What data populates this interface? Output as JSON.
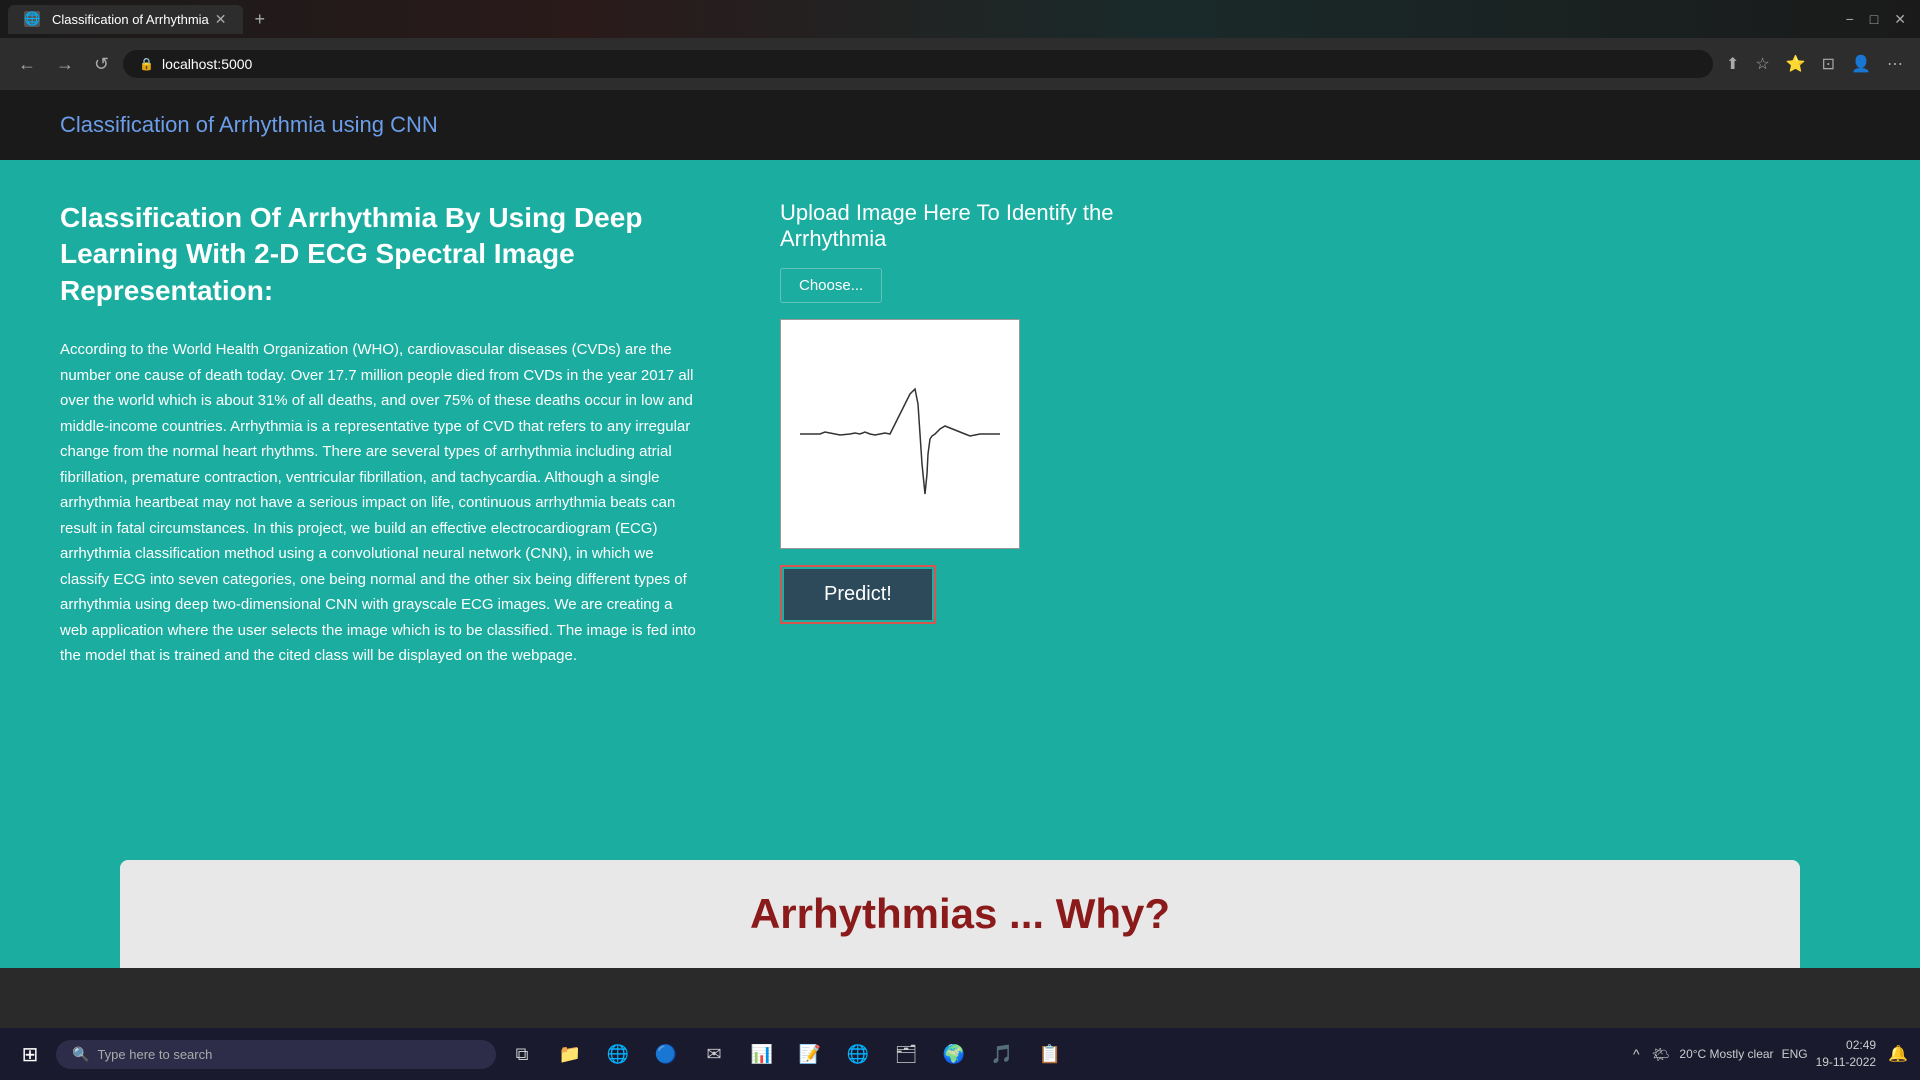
{
  "browser": {
    "tab_title": "Classification of Arrhythmia",
    "url": "localhost:5000",
    "new_tab_icon": "+",
    "back_icon": "←",
    "forward_icon": "→",
    "refresh_icon": "↺",
    "minimize_icon": "−",
    "maximize_icon": "□",
    "close_icon": "✕"
  },
  "header": {
    "title": "Classification of Arrhythmia using CNN"
  },
  "main": {
    "article_title": "Classification Of Arrhythmia By Using Deep Learning With 2-D ECG Spectral Image Representation:",
    "article_body": "According to the World Health Organization (WHO), cardiovascular diseases (CVDs) are the number one cause of death today. Over 17.7 million people died from CVDs in the year 2017 all over the world which is about 31% of all deaths, and over 75% of these deaths occur in low and middle-income countries. Arrhythmia is a representative type of CVD that refers to any irregular change from the normal heart rhythms. There are several types of arrhythmia including atrial fibrillation, premature contraction, ventricular fibrillation, and tachycardia. Although a single arrhythmia heartbeat may not have a serious impact on life, continuous arrhythmia beats can result in fatal circumstances. In this project, we build an effective electrocardiogram (ECG) arrhythmia classification method using a convolutional neural network (CNN), in which we classify ECG into seven categories, one being normal and the other six being different types of arrhythmia using deep two-dimensional CNN with grayscale ECG images. We are creating a web application where the user selects the image which is to be classified. The image is fed into the model that is trained and the cited class will be displayed on the webpage.",
    "upload_title": "Upload Image Here To Identify the Arrhythmia",
    "choose_btn_label": "Choose...",
    "predict_btn_label": "Predict!",
    "bottom_title": "Arrhythmias ... Why?"
  },
  "taskbar": {
    "search_placeholder": "Type here to search",
    "weather": "20°C  Mostly clear",
    "language": "ENG",
    "time": "02:49",
    "date": "19-11-2022"
  }
}
